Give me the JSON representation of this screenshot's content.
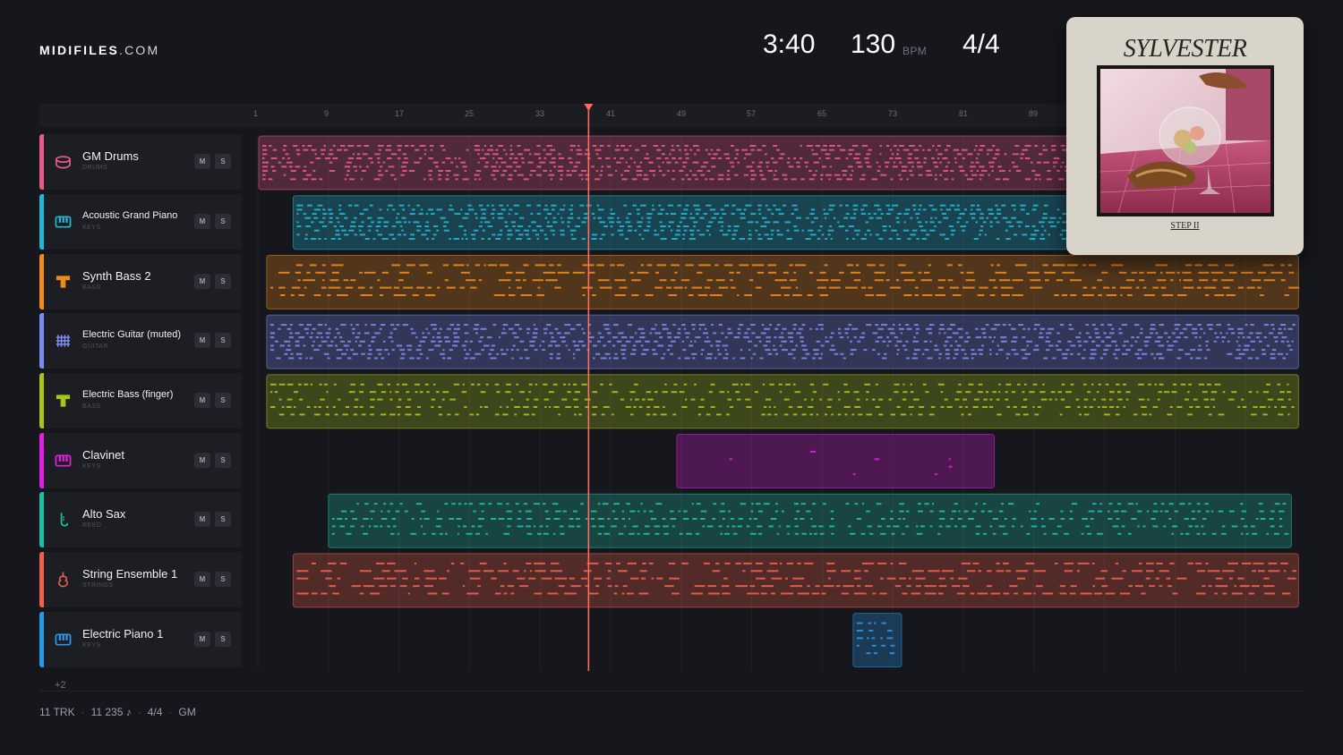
{
  "logo": {
    "bold": "MIDIFILES",
    "light": ".COM"
  },
  "header": {
    "duration": "3:40",
    "tempo": "130",
    "tempo_unit": "BPM",
    "time_signature": "4/4"
  },
  "cover": {
    "title": "SYLVESTER",
    "subtitle": "STEP II"
  },
  "ruler": {
    "ticks": [
      "1",
      "9",
      "17",
      "25",
      "33",
      "41",
      "49",
      "57",
      "65",
      "73",
      "81",
      "89"
    ]
  },
  "playhead": {
    "bar": 38.5
  },
  "tracks": [
    {
      "name": "GM Drums",
      "type": "DRUMS",
      "color": "#e85a8a",
      "icon": "drum-icon",
      "mute": "M",
      "solo": "S"
    },
    {
      "name": "Acoustic Grand Piano",
      "type": "KEYS",
      "color": "#23b6d4",
      "icon": "piano-icon",
      "mute": "M",
      "solo": "S"
    },
    {
      "name": "Synth Bass 2",
      "type": "BASS",
      "color": "#f08a1c",
      "icon": "bass-icon",
      "mute": "M",
      "solo": "S"
    },
    {
      "name": "Electric Guitar (muted)",
      "type": "GUITAR",
      "color": "#7d8af0",
      "icon": "guitar-icon",
      "mute": "M",
      "solo": "S"
    },
    {
      "name": "Electric Bass (finger)",
      "type": "BASS",
      "color": "#a6c41c",
      "icon": "bass-icon",
      "mute": "M",
      "solo": "S"
    },
    {
      "name": "Clavinet",
      "type": "KEYS",
      "color": "#e21ee0",
      "icon": "piano-icon",
      "mute": "M",
      "solo": "S"
    },
    {
      "name": "Alto Sax",
      "type": "REED",
      "color": "#1fbfa5",
      "icon": "sax-icon",
      "mute": "M",
      "solo": "S"
    },
    {
      "name": "String Ensemble 1",
      "type": "STRINGS",
      "color": "#f0604c",
      "icon": "violin-icon",
      "mute": "M",
      "solo": "S"
    },
    {
      "name": "Electric Piano 1",
      "type": "KEYS",
      "color": "#2a98e8",
      "icon": "piano-icon",
      "mute": "M",
      "solo": "S"
    }
  ],
  "more_tracks": "+2",
  "footer": {
    "tracks": "11 TRK",
    "notes": "11 235 ♪",
    "meter": "4/4",
    "standard": "GM"
  }
}
